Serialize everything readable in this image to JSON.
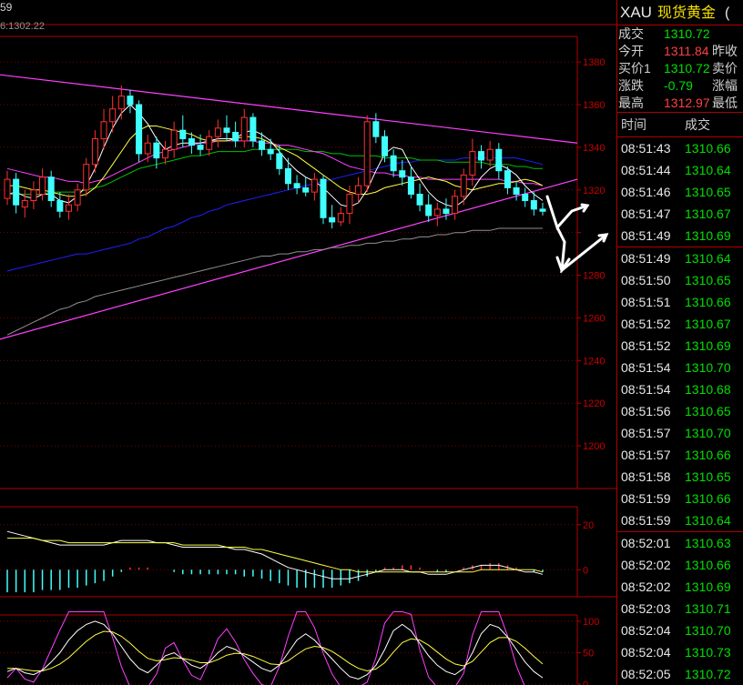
{
  "header": {
    "top_left_text": "59",
    "sub_left_text": "6:1302.22"
  },
  "quote": {
    "symbol": "XAU",
    "name": "现货黄金",
    "name_extra": "(",
    "rows": [
      {
        "label": "成交",
        "value": "1310.72",
        "color": "#00e000",
        "label2": ""
      },
      {
        "label": "今开",
        "value": "1311.84",
        "color": "#ff4040",
        "label2": "昨收"
      },
      {
        "label": "买价1",
        "value": "1310.72",
        "color": "#00e000",
        "label2": "卖价"
      },
      {
        "label": "涨跌",
        "value": "-0.79",
        "color": "#00e000",
        "label2": "涨幅"
      },
      {
        "label": "最高",
        "value": "1312.97",
        "color": "#ff4040",
        "label2": "最低"
      }
    ],
    "col_time": "时间",
    "col_price": "成交"
  },
  "ticks": [
    {
      "time": "08:51:43",
      "price": "1310.66"
    },
    {
      "time": "08:51:44",
      "price": "1310.64"
    },
    {
      "time": "08:51:46",
      "price": "1310.65"
    },
    {
      "time": "08:51:47",
      "price": "1310.67"
    },
    {
      "time": "08:51:49",
      "price": "1310.69"
    },
    {
      "time": "08:51:49",
      "price": "1310.64"
    },
    {
      "time": "08:51:50",
      "price": "1310.65"
    },
    {
      "time": "08:51:51",
      "price": "1310.66"
    },
    {
      "time": "08:51:52",
      "price": "1310.67"
    },
    {
      "time": "08:51:52",
      "price": "1310.69"
    },
    {
      "time": "08:51:54",
      "price": "1310.70"
    },
    {
      "time": "08:51:54",
      "price": "1310.68"
    },
    {
      "time": "08:51:56",
      "price": "1310.65"
    },
    {
      "time": "08:51:57",
      "price": "1310.70"
    },
    {
      "time": "08:51:57",
      "price": "1310.66"
    },
    {
      "time": "08:51:58",
      "price": "1310.65"
    },
    {
      "time": "08:51:59",
      "price": "1310.66"
    },
    {
      "time": "08:51:59",
      "price": "1310.64"
    },
    {
      "time": "08:52:01",
      "price": "1310.63"
    },
    {
      "time": "08:52:02",
      "price": "1310.66"
    },
    {
      "time": "08:52:02",
      "price": "1310.69"
    },
    {
      "time": "08:52:03",
      "price": "1310.71"
    },
    {
      "time": "08:52:04",
      "price": "1310.70"
    },
    {
      "time": "08:52:04",
      "price": "1310.73"
    },
    {
      "time": "08:52:05",
      "price": "1310.72"
    }
  ],
  "colors": {
    "up": "#ff3030",
    "down": "#40ffff",
    "grid": "#7a0000",
    "axis_text": "#c80000",
    "ma5": "#ffffff",
    "ma10": "#ffff40",
    "ma20": "#ff40ff",
    "ma30": "#00c000",
    "ma60": "#2020ff",
    "ma120": "#909090",
    "trendline": "#ff40ff"
  },
  "chart_data": [
    {
      "type": "candlestick",
      "ylim": [
        1180,
        1392
      ],
      "yticks": [
        1200,
        1220,
        1240,
        1260,
        1280,
        1300,
        1320,
        1340,
        1360,
        1380
      ],
      "ytick_labels": [
        "1200",
        "1220",
        "1240",
        "1260",
        "1280",
        "",
        "1320",
        "1340",
        "1360",
        "1380"
      ],
      "candles": [
        [
          1316,
          1329,
          1313,
          1325
        ],
        [
          1325,
          1328,
          1309,
          1313
        ],
        [
          1312,
          1320,
          1307,
          1315
        ],
        [
          1315,
          1324,
          1311,
          1320
        ],
        [
          1318,
          1330,
          1315,
          1326
        ],
        [
          1326,
          1329,
          1312,
          1315
        ],
        [
          1315,
          1319,
          1307,
          1310
        ],
        [
          1310,
          1318,
          1306,
          1313
        ],
        [
          1313,
          1323,
          1310,
          1320
        ],
        [
          1320,
          1335,
          1317,
          1332
        ],
        [
          1332,
          1348,
          1328,
          1344
        ],
        [
          1344,
          1358,
          1339,
          1352
        ],
        [
          1352,
          1364,
          1347,
          1358
        ],
        [
          1358,
          1369,
          1353,
          1364
        ],
        [
          1364,
          1367,
          1356,
          1360
        ],
        [
          1360,
          1362,
          1333,
          1337
        ],
        [
          1337,
          1346,
          1333,
          1342
        ],
        [
          1342,
          1345,
          1330,
          1335
        ],
        [
          1335,
          1343,
          1332,
          1339
        ],
        [
          1339,
          1352,
          1335,
          1348
        ],
        [
          1348,
          1355,
          1340,
          1344
        ],
        [
          1344,
          1347,
          1337,
          1341
        ],
        [
          1341,
          1346,
          1336,
          1339
        ],
        [
          1339,
          1348,
          1336,
          1345
        ],
        [
          1345,
          1353,
          1340,
          1349
        ],
        [
          1349,
          1355,
          1343,
          1347
        ],
        [
          1347,
          1352,
          1340,
          1343
        ],
        [
          1343,
          1358,
          1340,
          1354
        ],
        [
          1354,
          1356,
          1340,
          1343
        ],
        [
          1343,
          1347,
          1336,
          1339
        ],
        [
          1339,
          1344,
          1334,
          1337
        ],
        [
          1337,
          1341,
          1327,
          1330
        ],
        [
          1330,
          1335,
          1320,
          1323
        ],
        [
          1323,
          1327,
          1318,
          1321
        ],
        [
          1321,
          1326,
          1317,
          1319
        ],
        [
          1319,
          1328,
          1315,
          1325
        ],
        [
          1325,
          1327,
          1304,
          1307
        ],
        [
          1307,
          1313,
          1302,
          1305
        ],
        [
          1305,
          1312,
          1303,
          1309
        ],
        [
          1309,
          1322,
          1304,
          1318
        ],
        [
          1318,
          1326,
          1314,
          1322
        ],
        [
          1322,
          1355,
          1319,
          1352
        ],
        [
          1352,
          1356,
          1342,
          1345
        ],
        [
          1345,
          1348,
          1333,
          1336
        ],
        [
          1336,
          1339,
          1326,
          1329
        ],
        [
          1329,
          1334,
          1322,
          1326
        ],
        [
          1326,
          1331,
          1316,
          1318
        ],
        [
          1318,
          1323,
          1310,
          1313
        ],
        [
          1313,
          1318,
          1305,
          1308
        ],
        [
          1308,
          1314,
          1303,
          1311
        ],
        [
          1311,
          1316,
          1306,
          1309
        ],
        [
          1309,
          1320,
          1306,
          1317
        ],
        [
          1317,
          1330,
          1313,
          1327
        ],
        [
          1327,
          1344,
          1322,
          1338
        ],
        [
          1338,
          1341,
          1330,
          1334
        ],
        [
          1334,
          1343,
          1331,
          1339
        ],
        [
          1339,
          1342,
          1325,
          1329
        ],
        [
          1329,
          1331,
          1318,
          1321
        ],
        [
          1321,
          1324,
          1315,
          1318
        ],
        [
          1318,
          1321,
          1312,
          1315
        ],
        [
          1315,
          1319,
          1308,
          1311
        ],
        [
          1311,
          1314,
          1308,
          1310
        ]
      ],
      "ma5": [
        1318,
        1319,
        1317,
        1316,
        1318,
        1318,
        1315,
        1314,
        1317,
        1322,
        1330,
        1340,
        1349,
        1356,
        1360,
        1356,
        1351,
        1344,
        1339,
        1341,
        1342,
        1342,
        1342,
        1343,
        1344,
        1344,
        1344,
        1347,
        1348,
        1346,
        1343,
        1338,
        1333,
        1329,
        1326,
        1324,
        1321,
        1317,
        1313,
        1312,
        1314,
        1320,
        1329,
        1337,
        1340,
        1339,
        1331,
        1325,
        1319,
        1315,
        1313,
        1312,
        1315,
        1320,
        1326,
        1330,
        1332,
        1330,
        1327,
        1322,
        1318,
        1315
      ],
      "ma10": [
        1322,
        1322,
        1321,
        1320,
        1320,
        1319,
        1318,
        1317,
        1317,
        1318,
        1321,
        1326,
        1332,
        1338,
        1344,
        1348,
        1350,
        1350,
        1349,
        1348,
        1347,
        1346,
        1344,
        1343,
        1343,
        1343,
        1344,
        1345,
        1345,
        1344,
        1342,
        1340,
        1338,
        1336,
        1333,
        1330,
        1327,
        1324,
        1321,
        1319,
        1318,
        1318,
        1319,
        1321,
        1322,
        1323,
        1324,
        1325,
        1326,
        1325,
        1324,
        1322,
        1321,
        1320,
        1321,
        1322,
        1323,
        1323,
        1324,
        1325,
        1324,
        1322
      ],
      "ma20": [
        1330,
        1329,
        1328,
        1327,
        1326,
        1326,
        1325,
        1324,
        1324,
        1323,
        1324,
        1325,
        1327,
        1329,
        1331,
        1333,
        1335,
        1337,
        1338,
        1339,
        1340,
        1341,
        1342,
        1342,
        1343,
        1343,
        1343,
        1343,
        1343,
        1342,
        1342,
        1341,
        1341,
        1340,
        1339,
        1338,
        1337,
        1335,
        1333,
        1331,
        1330,
        1329,
        1328,
        1328,
        1327,
        1327,
        1326,
        1326,
        1325,
        1325,
        1325,
        1325,
        1325,
        1325,
        1325,
        1325,
        1325,
        1324,
        1324,
        1323,
        1323,
        1322
      ],
      "ma30": [
        1318,
        1318,
        1318,
        1318,
        1318,
        1319,
        1319,
        1319,
        1319,
        1320,
        1321,
        1322,
        1324,
        1326,
        1328,
        1330,
        1331,
        1332,
        1333,
        1334,
        1335,
        1336,
        1336,
        1337,
        1338,
        1338,
        1338,
        1338,
        1339,
        1339,
        1339,
        1339,
        1339,
        1339,
        1338,
        1338,
        1338,
        1337,
        1337,
        1336,
        1336,
        1336,
        1336,
        1335,
        1335,
        1335,
        1335,
        1334,
        1334,
        1334,
        1333,
        1333,
        1333,
        1333,
        1333,
        1332,
        1332,
        1332,
        1331,
        1331,
        1330,
        1330
      ],
      "ma60": [
        1282,
        1283,
        1284,
        1285,
        1286,
        1287,
        1288,
        1289,
        1290,
        1290,
        1291,
        1292,
        1293,
        1294,
        1295,
        1297,
        1298,
        1300,
        1302,
        1303,
        1305,
        1307,
        1308,
        1310,
        1311,
        1313,
        1314,
        1315,
        1316,
        1317,
        1318,
        1319,
        1320,
        1321,
        1322,
        1323,
        1324,
        1325,
        1326,
        1327,
        1328,
        1329,
        1330,
        1331,
        1332,
        1333,
        1333,
        1334,
        1334,
        1334,
        1334,
        1334,
        1335,
        1335,
        1335,
        1335,
        1335,
        1335,
        1335,
        1334,
        1333,
        1332
      ],
      "ma120": [
        1252,
        1254,
        1256,
        1258,
        1260,
        1262,
        1264,
        1265,
        1267,
        1268,
        1270,
        1271,
        1272,
        1273,
        1274,
        1275,
        1276,
        1277,
        1278,
        1279,
        1280,
        1281,
        1282,
        1283,
        1284,
        1285,
        1286,
        1287,
        1288,
        1289,
        1289,
        1290,
        1290,
        1291,
        1291,
        1292,
        1292,
        1293,
        1293,
        1294,
        1294,
        1295,
        1295,
        1296,
        1296,
        1297,
        1297,
        1298,
        1298,
        1299,
        1299,
        1300,
        1300,
        1301,
        1301,
        1301,
        1302,
        1302,
        1302,
        1302,
        1302,
        1302
      ],
      "upper_trendline": [
        1374,
        1342
      ],
      "lower_trendline": [
        1250,
        1325
      ]
    },
    {
      "type": "line",
      "ylim": [
        -12,
        28
      ],
      "yticks": [
        0,
        20
      ],
      "ytick_labels": [
        "0",
        "20"
      ],
      "dif": [
        17,
        16,
        15,
        14,
        13,
        12,
        11,
        11,
        11,
        11,
        11,
        11,
        12,
        13,
        13,
        13,
        13,
        12,
        12,
        11,
        10,
        10,
        10,
        10,
        10,
        10,
        9,
        9,
        8,
        7,
        5,
        3,
        1,
        0,
        -1,
        -2,
        -3,
        -4,
        -4,
        -4,
        -3,
        -2,
        -1,
        0,
        0,
        0,
        -1,
        -1,
        -2,
        -2,
        -2,
        -1,
        0,
        1,
        2,
        2,
        2,
        1,
        0,
        -1,
        -1,
        -2
      ],
      "dea": [
        14,
        14,
        14,
        14,
        13,
        13,
        13,
        12,
        12,
        12,
        12,
        12,
        12,
        12,
        12,
        12,
        12,
        12,
        12,
        12,
        11,
        11,
        11,
        11,
        11,
        10,
        10,
        10,
        9,
        9,
        8,
        7,
        6,
        5,
        4,
        3,
        2,
        1,
        0,
        0,
        -1,
        -1,
        -1,
        -1,
        -1,
        -1,
        -1,
        -1,
        -1,
        -1,
        -1,
        -1,
        -1,
        -1,
        0,
        0,
        0,
        0,
        0,
        0,
        0,
        -1
      ],
      "hist": [
        -10,
        -10,
        -10,
        -10,
        -9,
        -9,
        -9,
        -8,
        -8,
        -7,
        -6,
        -5,
        -3,
        -1,
        1,
        1,
        1,
        0,
        0,
        -1,
        -2,
        -2,
        -2,
        -2,
        -2,
        -2,
        -2,
        -3,
        -3,
        -4,
        -5,
        -6,
        -7,
        -8,
        -8,
        -8,
        -8,
        -8,
        -7,
        -6,
        -5,
        -3,
        -1,
        1,
        1,
        2,
        2,
        1,
        0,
        -1,
        -1,
        0,
        1,
        2,
        2,
        3,
        3,
        2,
        1,
        0,
        -1,
        -1
      ]
    },
    {
      "type": "line",
      "ylim": [
        0,
        110
      ],
      "yticks": [
        0,
        50,
        100
      ],
      "ytick_labels": [
        "0",
        "50",
        "100"
      ],
      "k": [
        20,
        25,
        18,
        15,
        22,
        35,
        50,
        70,
        85,
        95,
        100,
        95,
        80,
        60,
        40,
        25,
        18,
        30,
        45,
        50,
        40,
        30,
        25,
        35,
        50,
        60,
        55,
        45,
        35,
        25,
        20,
        30,
        50,
        70,
        80,
        70,
        55,
        40,
        25,
        12,
        8,
        15,
        30,
        55,
        85,
        95,
        85,
        65,
        45,
        30,
        20,
        15,
        25,
        50,
        80,
        95,
        90,
        75,
        55,
        35,
        20,
        10
      ],
      "d": [
        25,
        25,
        23,
        21,
        21,
        25,
        32,
        42,
        55,
        68,
        78,
        84,
        83,
        76,
        65,
        52,
        41,
        37,
        39,
        42,
        41,
        38,
        34,
        34,
        39,
        46,
        49,
        48,
        44,
        38,
        32,
        31,
        37,
        47,
        56,
        60,
        58,
        52,
        43,
        33,
        25,
        21,
        24,
        34,
        51,
        66,
        72,
        70,
        62,
        51,
        40,
        32,
        29,
        36,
        51,
        66,
        74,
        74,
        68,
        57,
        44,
        32
      ],
      "j": [
        10,
        25,
        8,
        3,
        24,
        55,
        86,
        126,
        145,
        149,
        144,
        117,
        74,
        28,
        -10,
        -29,
        -30,
        16,
        57,
        66,
        38,
        14,
        7,
        37,
        72,
        88,
        67,
        39,
        17,
        -1,
        -4,
        28,
        76,
        116,
        128,
        90,
        49,
        16,
        -11,
        -30,
        -26,
        3,
        42,
        97,
        153,
        153,
        111,
        55,
        11,
        -12,
        -20,
        -19,
        17,
        78,
        138,
        153,
        122,
        77,
        29,
        -9,
        -28,
        -34
      ]
    }
  ]
}
